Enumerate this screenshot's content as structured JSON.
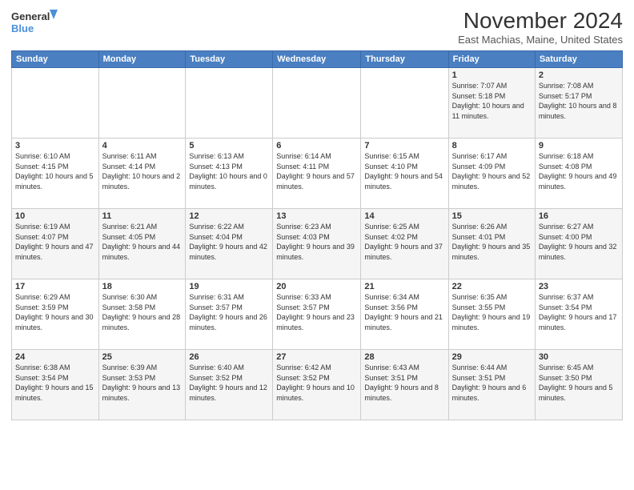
{
  "logo": {
    "line1": "General",
    "line2": "Blue"
  },
  "title": "November 2024",
  "location": "East Machias, Maine, United States",
  "header_days": [
    "Sunday",
    "Monday",
    "Tuesday",
    "Wednesday",
    "Thursday",
    "Friday",
    "Saturday"
  ],
  "weeks": [
    [
      {
        "day": "",
        "info": ""
      },
      {
        "day": "",
        "info": ""
      },
      {
        "day": "",
        "info": ""
      },
      {
        "day": "",
        "info": ""
      },
      {
        "day": "",
        "info": ""
      },
      {
        "day": "1",
        "info": "Sunrise: 7:07 AM\nSunset: 5:18 PM\nDaylight: 10 hours and 11 minutes."
      },
      {
        "day": "2",
        "info": "Sunrise: 7:08 AM\nSunset: 5:17 PM\nDaylight: 10 hours and 8 minutes."
      }
    ],
    [
      {
        "day": "3",
        "info": "Sunrise: 6:10 AM\nSunset: 4:15 PM\nDaylight: 10 hours and 5 minutes."
      },
      {
        "day": "4",
        "info": "Sunrise: 6:11 AM\nSunset: 4:14 PM\nDaylight: 10 hours and 2 minutes."
      },
      {
        "day": "5",
        "info": "Sunrise: 6:13 AM\nSunset: 4:13 PM\nDaylight: 10 hours and 0 minutes."
      },
      {
        "day": "6",
        "info": "Sunrise: 6:14 AM\nSunset: 4:11 PM\nDaylight: 9 hours and 57 minutes."
      },
      {
        "day": "7",
        "info": "Sunrise: 6:15 AM\nSunset: 4:10 PM\nDaylight: 9 hours and 54 minutes."
      },
      {
        "day": "8",
        "info": "Sunrise: 6:17 AM\nSunset: 4:09 PM\nDaylight: 9 hours and 52 minutes."
      },
      {
        "day": "9",
        "info": "Sunrise: 6:18 AM\nSunset: 4:08 PM\nDaylight: 9 hours and 49 minutes."
      }
    ],
    [
      {
        "day": "10",
        "info": "Sunrise: 6:19 AM\nSunset: 4:07 PM\nDaylight: 9 hours and 47 minutes."
      },
      {
        "day": "11",
        "info": "Sunrise: 6:21 AM\nSunset: 4:05 PM\nDaylight: 9 hours and 44 minutes."
      },
      {
        "day": "12",
        "info": "Sunrise: 6:22 AM\nSunset: 4:04 PM\nDaylight: 9 hours and 42 minutes."
      },
      {
        "day": "13",
        "info": "Sunrise: 6:23 AM\nSunset: 4:03 PM\nDaylight: 9 hours and 39 minutes."
      },
      {
        "day": "14",
        "info": "Sunrise: 6:25 AM\nSunset: 4:02 PM\nDaylight: 9 hours and 37 minutes."
      },
      {
        "day": "15",
        "info": "Sunrise: 6:26 AM\nSunset: 4:01 PM\nDaylight: 9 hours and 35 minutes."
      },
      {
        "day": "16",
        "info": "Sunrise: 6:27 AM\nSunset: 4:00 PM\nDaylight: 9 hours and 32 minutes."
      }
    ],
    [
      {
        "day": "17",
        "info": "Sunrise: 6:29 AM\nSunset: 3:59 PM\nDaylight: 9 hours and 30 minutes."
      },
      {
        "day": "18",
        "info": "Sunrise: 6:30 AM\nSunset: 3:58 PM\nDaylight: 9 hours and 28 minutes."
      },
      {
        "day": "19",
        "info": "Sunrise: 6:31 AM\nSunset: 3:57 PM\nDaylight: 9 hours and 26 minutes."
      },
      {
        "day": "20",
        "info": "Sunrise: 6:33 AM\nSunset: 3:57 PM\nDaylight: 9 hours and 23 minutes."
      },
      {
        "day": "21",
        "info": "Sunrise: 6:34 AM\nSunset: 3:56 PM\nDaylight: 9 hours and 21 minutes."
      },
      {
        "day": "22",
        "info": "Sunrise: 6:35 AM\nSunset: 3:55 PM\nDaylight: 9 hours and 19 minutes."
      },
      {
        "day": "23",
        "info": "Sunrise: 6:37 AM\nSunset: 3:54 PM\nDaylight: 9 hours and 17 minutes."
      }
    ],
    [
      {
        "day": "24",
        "info": "Sunrise: 6:38 AM\nSunset: 3:54 PM\nDaylight: 9 hours and 15 minutes."
      },
      {
        "day": "25",
        "info": "Sunrise: 6:39 AM\nSunset: 3:53 PM\nDaylight: 9 hours and 13 minutes."
      },
      {
        "day": "26",
        "info": "Sunrise: 6:40 AM\nSunset: 3:52 PM\nDaylight: 9 hours and 12 minutes."
      },
      {
        "day": "27",
        "info": "Sunrise: 6:42 AM\nSunset: 3:52 PM\nDaylight: 9 hours and 10 minutes."
      },
      {
        "day": "28",
        "info": "Sunrise: 6:43 AM\nSunset: 3:51 PM\nDaylight: 9 hours and 8 minutes."
      },
      {
        "day": "29",
        "info": "Sunrise: 6:44 AM\nSunset: 3:51 PM\nDaylight: 9 hours and 6 minutes."
      },
      {
        "day": "30",
        "info": "Sunrise: 6:45 AM\nSunset: 3:50 PM\nDaylight: 9 hours and 5 minutes."
      }
    ]
  ]
}
